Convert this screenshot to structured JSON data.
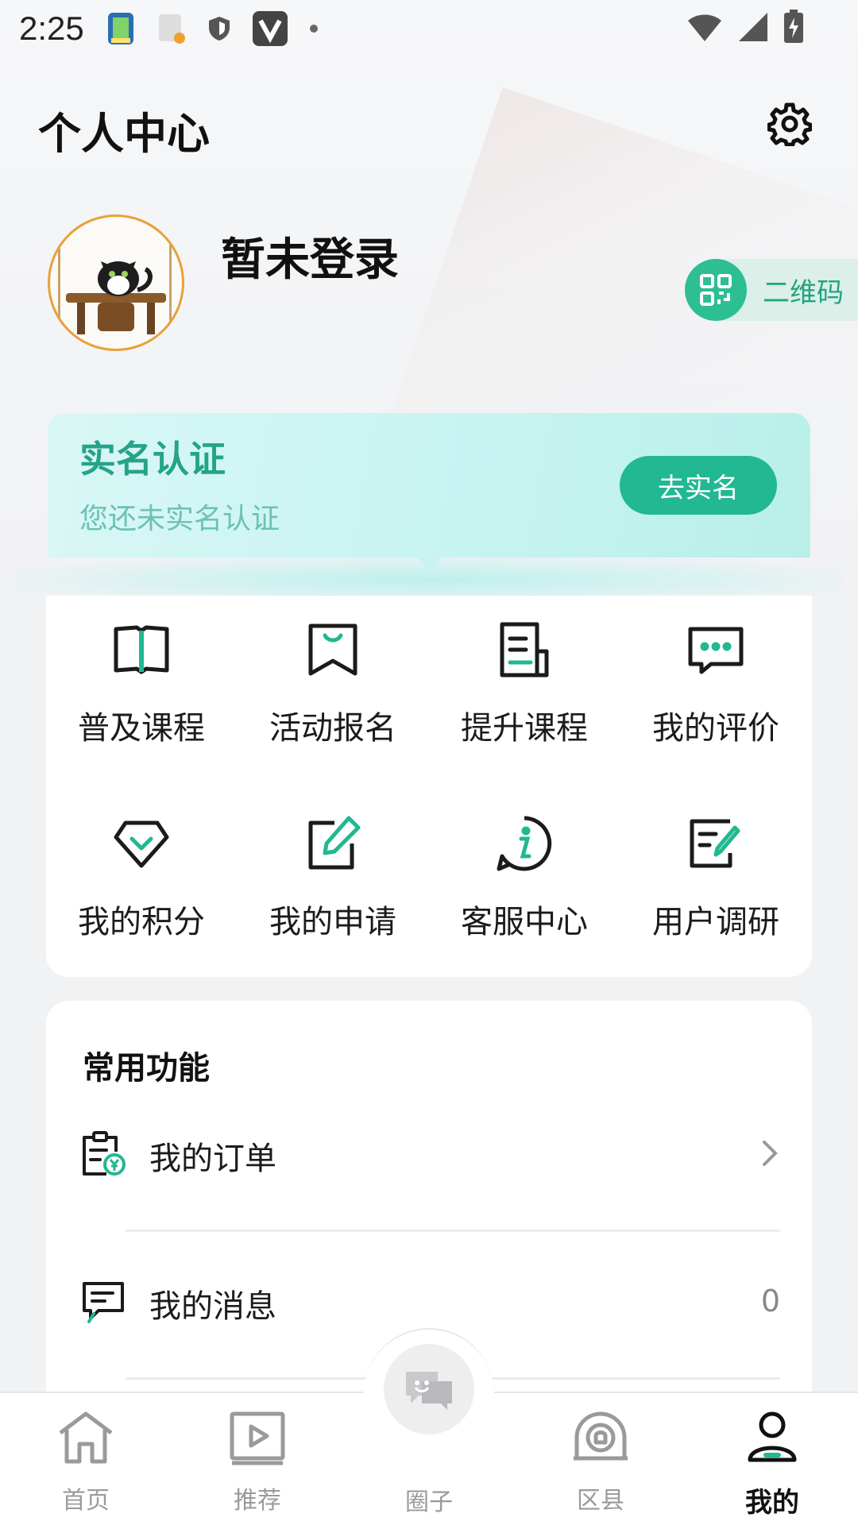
{
  "status_bar": {
    "time": "2:25"
  },
  "header": {
    "title": "个人中心"
  },
  "profile": {
    "login_status": "暂未登录",
    "qr_label": "二维码"
  },
  "verify": {
    "title": "实名认证",
    "subtitle": "您还未实名认证",
    "button": "去实名"
  },
  "grid": [
    {
      "label": "普及课程",
      "icon": "book-icon"
    },
    {
      "label": "活动报名",
      "icon": "bookmark-icon"
    },
    {
      "label": "提升课程",
      "icon": "document-icon"
    },
    {
      "label": "我的评价",
      "icon": "chat-icon"
    },
    {
      "label": "我的积分",
      "icon": "diamond-icon"
    },
    {
      "label": "我的申请",
      "icon": "edit-icon"
    },
    {
      "label": "客服中心",
      "icon": "info-icon"
    },
    {
      "label": "用户调研",
      "icon": "survey-icon"
    }
  ],
  "functions": {
    "title": "常用功能",
    "items": [
      {
        "label": "我的订单",
        "right": ""
      },
      {
        "label": "我的消息",
        "right": "0"
      }
    ]
  },
  "tabs": [
    {
      "label": "首页",
      "icon": "home-icon"
    },
    {
      "label": "推荐",
      "icon": "play-icon"
    },
    {
      "label": "圈子",
      "icon": "circle-chat-icon"
    },
    {
      "label": "区县",
      "icon": "district-icon"
    },
    {
      "label": "我的",
      "icon": "profile-icon"
    }
  ],
  "colors": {
    "accent": "#21b892",
    "background": "#f1f2f4"
  }
}
